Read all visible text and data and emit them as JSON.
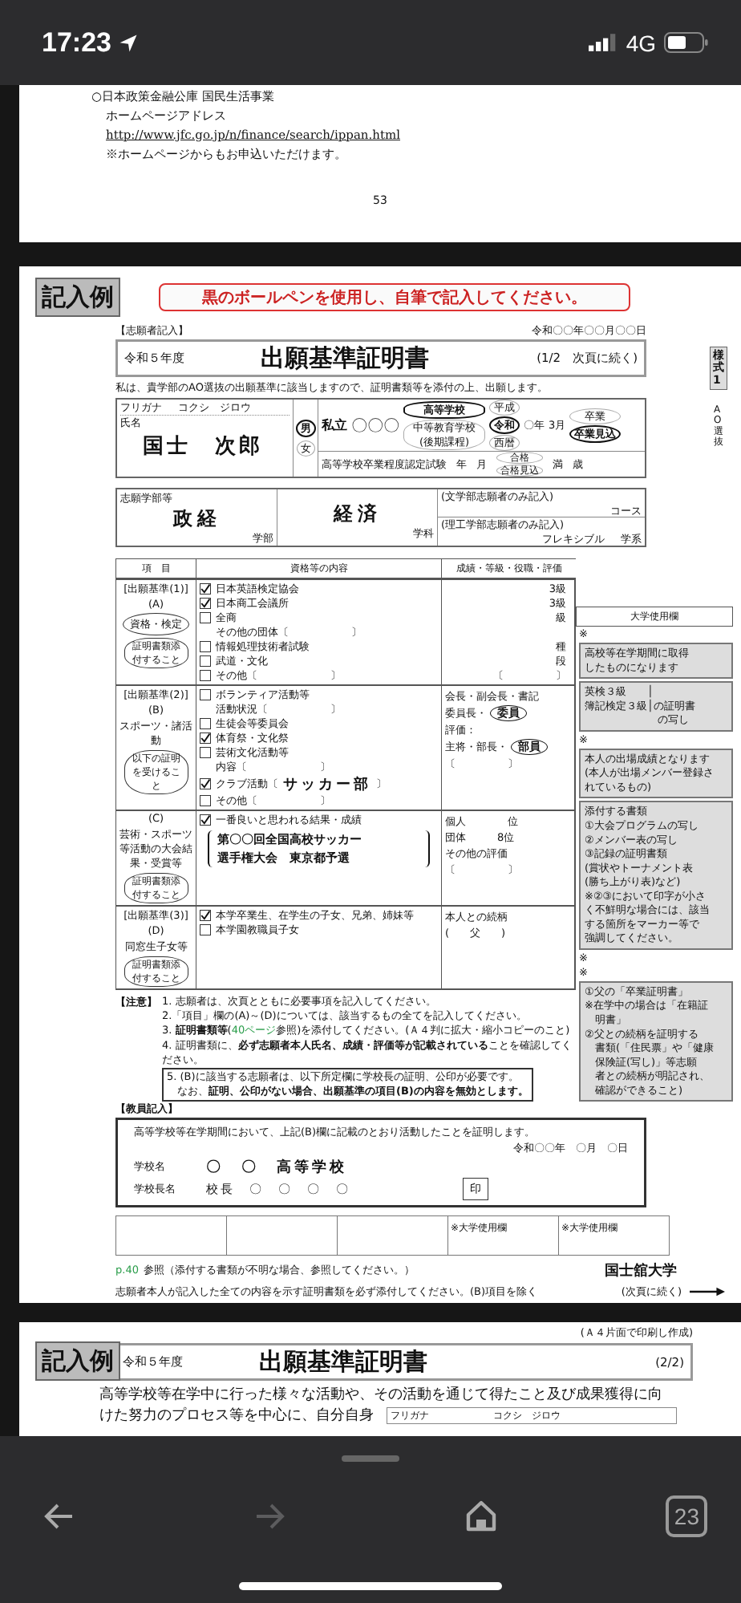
{
  "status_bar": {
    "time": "17:23",
    "network": "4G"
  },
  "page_top": {
    "lines": [
      {
        "kind": "text",
        "text": "○日本政策金融公庫 国民生活事業"
      },
      {
        "kind": "text",
        "text": "ホームページアドレス"
      },
      {
        "kind": "link",
        "text": "http://www.jfc.go.jp/n/finance/search/ippan.html"
      },
      {
        "kind": "text",
        "text": "※ホームページからもお申込いただけます。"
      }
    ],
    "page_number": "53"
  },
  "form": {
    "badge": "記入例",
    "notice": "黒のボールペンを使用し、自筆で記入してください。",
    "side_tab": "様式1",
    "side_note": "AO選抜",
    "applicant_label": "【志願者記入】",
    "date": "令和〇〇年〇〇月〇〇日",
    "title_box": {
      "year": "令和５年度",
      "title": "出願基準証明書",
      "page": "(1/2　次頁に続く)"
    },
    "declaration": "私は、貴学部のAO選抜の出願基準に該当しますので、証明書類等を添付の上、出願します。",
    "applicant": {
      "furigana_label": "フリガナ",
      "furigana": "コクシ　ジロウ",
      "name_label": "氏名",
      "name": "国士　次郎",
      "sex": [
        {
          "label": "男",
          "selected": true
        },
        {
          "label": "女",
          "selected": false
        }
      ],
      "school_kind": "私立",
      "school_name": "〇〇〇",
      "school_types": [
        {
          "label": "高等学校",
          "selected": true
        },
        {
          "label": "中等教育学校(後期課程)",
          "selected": false
        }
      ],
      "eras": [
        {
          "label": "平成",
          "selected": false
        },
        {
          "label": "令和",
          "selected": true
        },
        {
          "label": "西暦",
          "selected": false
        }
      ],
      "year": "〇年",
      "month": "3月",
      "graduation": [
        {
          "label": "卒業",
          "selected": false
        },
        {
          "label": "卒業見込",
          "selected": true
        }
      ],
      "exam_label": "高等学校卒業程度認定試験",
      "exam_year": "年",
      "exam_month": "月",
      "pass": [
        {
          "label": "合格",
          "selected": false
        },
        {
          "label": "合格見込",
          "selected": false
        }
      ],
      "age_prefix": "満",
      "age_suffix": "歳"
    },
    "faculty": {
      "label": "志願学部等",
      "faculty": "政経",
      "faculty_suffix": "学部",
      "department": "経済",
      "department_suffix": "学科",
      "note_1": "(文学部志願者のみ記入)",
      "course": "コース",
      "note_2": "(理工学部志願者のみ記入)",
      "field": "学系",
      "field_value": "フレキシブル"
    },
    "table": {
      "columns": [
        "項　目",
        "資格等の内容",
        "成績・等級・役職・評価",
        "大学使用欄"
      ],
      "sections": [
        {
          "criterion": "[出願基準(1)]",
          "letter": "(A)",
          "label": "資格・検定",
          "requirement": "証明書類添付すること",
          "univ_mark": "※",
          "items": [
            {
              "kind": "check",
              "label": "日本英語検定協会",
              "checked": true,
              "result": "3級"
            },
            {
              "kind": "check",
              "label": "日本商工会議所",
              "checked": true,
              "result": "3級"
            },
            {
              "kind": "check",
              "label": "全商",
              "checked": false,
              "result": "級"
            },
            {
              "kind": "line",
              "label": "その他の団体〔　　　　　　〕"
            },
            {
              "kind": "check",
              "label": "情報処理技術者試験",
              "checked": false,
              "result": "種"
            },
            {
              "kind": "check",
              "label": "武道・文化",
              "checked": false,
              "result": "段"
            },
            {
              "kind": "check",
              "label": "その他〔　　　　　　　〕",
              "checked": false,
              "result": "〔　　　　　〕"
            }
          ],
          "callouts": [
            {
              "lines": [
                "高校等在学期間に取得",
                "したものになります"
              ]
            },
            {
              "lines": [
                "英検３級　　│",
                "簿記検定３級│の証明書",
                "　　　　　　　の写し"
              ]
            }
          ]
        },
        {
          "criterion": "[出願基準(2)]",
          "letter": "(B)",
          "label": "スポーツ・諸活動",
          "requirement": "以下の証明を受けること",
          "univ_mark": "※",
          "items": [
            {
              "kind": "check",
              "label": "ボランティア活動等",
              "checked": false
            },
            {
              "kind": "line",
              "label": "活動状況〔　　　　　　〕"
            },
            {
              "kind": "check",
              "label": "生徒会等委員会",
              "checked": false
            },
            {
              "kind": "check",
              "label": "体育祭・文化祭",
              "checked": true
            },
            {
              "kind": "check",
              "label": "芸術文化活動等",
              "checked": false
            },
            {
              "kind": "line",
              "label": "内容〔　　　　　　　〕"
            },
            {
              "kind": "check",
              "label": "クラブ活動〔",
              "checked": true,
              "value": "サッカー部",
              "suffix": "〕"
            },
            {
              "kind": "check",
              "label": "その他〔　　　　　　〕",
              "checked": false
            }
          ],
          "results": [
            {
              "text": "会長・副会長・書記"
            },
            {
              "text": "委員長・",
              "circled": "委員"
            },
            {
              "text": "評価："
            },
            {
              "text": "主将・部長・",
              "circled": "部員"
            },
            {
              "text": "〔　　　　　〕"
            }
          ],
          "callouts": [
            {
              "lines": [
                "本人の出場成績となります",
                "(本人が出場メンバー登録さ",
                "れているもの)"
              ]
            },
            {
              "lines": [
                "添付する書類",
                "①大会プログラムの写し",
                "②メンバー表の写し",
                "③記録の証明書類",
                "(賞状やトーナメント表",
                "(勝ち上がり表)など)",
                "※②③において印字が小さ",
                "く不鮮明な場合には、該当",
                "する箇所をマーカー等で",
                "強調してください。"
              ]
            }
          ]
        },
        {
          "criterion": "(C)",
          "label": "芸術・スポーツ等活動の大会結果・受賞等",
          "requirement": "証明書類添付すること",
          "univ_mark": "※",
          "items": [
            {
              "kind": "check",
              "label": "一番良いと思われる結果・成績",
              "checked": true
            },
            {
              "kind": "box",
              "lines": [
                "第〇〇回全国高校サッカー",
                "選手権大会　東京都予選"
              ]
            }
          ],
          "results": [
            {
              "text": "個人　　　　位"
            },
            {
              "text": "団体　　　8位"
            },
            {
              "text": "その他の評価"
            },
            {
              "text": "〔　　　　　〕"
            }
          ]
        },
        {
          "criterion": "[出願基準(3)]",
          "letter": "(D)",
          "label": "同窓生子女等",
          "requirement": "証明書類添付すること",
          "univ_mark": "※",
          "items": [
            {
              "kind": "check",
              "label": "本学卒業生、在学生の子女、兄弟、姉妹等",
              "checked": true
            },
            {
              "kind": "check",
              "label": "本学園教職員子女",
              "checked": false
            }
          ],
          "results": [
            {
              "text": "本人との続柄"
            },
            {
              "text": "(　　父　　)"
            }
          ],
          "callouts": [
            {
              "lines": [
                "①父の「卒業証明書」",
                "※在学中の場合は「在籍証",
                "　明書」",
                "②父との続柄を証明する",
                "　書類(「住民票」や「健康",
                "　保険証(写し)」等志願",
                "　者との続柄が明記され、",
                "　確認ができること)"
              ]
            }
          ]
        }
      ]
    },
    "notes": {
      "label": "【注意】",
      "items": [
        {
          "kind": "plain",
          "text": "1. 志願者は、次頁とともに必要事項を記入してください。"
        },
        {
          "kind": "plain",
          "text": "2.「項目」欄の(A)～(D)については、該当するもの全てを記入してください。"
        },
        {
          "kind": "ref",
          "before": "3. **証明書類等**(",
          "link": "40ページ",
          "after": "参照)を添付してください。(Ａ４判に拡大・縮小コピーのこと)"
        },
        {
          "kind": "plain",
          "text": "4. 証明書類に、**必ず志願者本人氏名、成績・評価等が記載されている**ことを確認してください。"
        },
        {
          "kind": "boxed",
          "lines": [
            "5. (B)に該当する志願者は、以下所定欄に学校長の証明、公印が必要です。",
            "　なお、**証明、公印がない場合、出願基準の項目(B)の内容を無効とします。**"
          ]
        }
      ]
    },
    "teacher": {
      "label": "【教員記入】",
      "statement": "高等学校等在学期間において、上記(B)欄に記載のとおり活動したことを証明します。",
      "date": "令和〇〇年　〇月　〇日",
      "school_label": "学校名",
      "school": "〇　〇　高等学校",
      "principal_label": "学校長名",
      "principal": "校長　〇　〇　〇　〇",
      "seal": "印"
    },
    "use_boxes": [
      "※大学使用欄",
      "※大学使用欄"
    ],
    "footer": {
      "ref_link": "p.40",
      "ref_text": "参照（添付する書類が不明な場合、参照してください。）",
      "instruction": "志願者本人が記入した全ての内容を示す証明書類を必ず添付してください。(B)項目を除く",
      "university": "国士舘大学",
      "continued": "(次頁に続く)"
    }
  },
  "page_next": {
    "print_note": "(Ａ４片面で印刷し作成)",
    "badge": "記入例",
    "year": "令和５年度",
    "title": "出願基準証明書",
    "page": "(2/2)",
    "intro_lines": [
      "高等学校等在学中に行った様々な活動や、その活動を通じて得たこと及び成果獲得に向",
      "けた努力のプロセス等を中心に、自分自身"
    ],
    "furigana_label": "フリガナ",
    "furigana": "コクシ　ジロウ"
  },
  "nav": {
    "back": {
      "disabled": false
    },
    "forward": {
      "disabled": true
    },
    "tab_count": "23"
  }
}
